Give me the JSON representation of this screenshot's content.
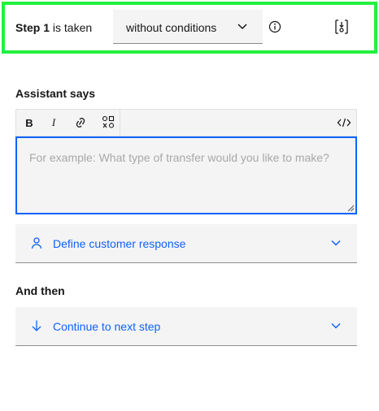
{
  "header": {
    "step_prefix": "Step 1",
    "step_suffix": " is taken",
    "condition_value": "without conditions",
    "icons": [
      "chevron-down-icon",
      "info-icon",
      "sort-icon"
    ],
    "highlight_color": "#24f03f"
  },
  "assistant": {
    "title": "Assistant says",
    "toolbar": {
      "bold": "B",
      "italic": "I",
      "icons": [
        "bold-icon",
        "italic-icon",
        "link-icon",
        "variable-icon",
        "code-icon"
      ]
    },
    "placeholder": "For example: What type of transfer would you like to make?"
  },
  "response": {
    "label": "Define customer response",
    "icon": "user-icon"
  },
  "and_then": {
    "title": "And then",
    "label": "Continue to next step",
    "icon": "arrow-down-icon"
  },
  "colors": {
    "accent": "#0f62fe",
    "field_bg": "#f4f4f4"
  }
}
